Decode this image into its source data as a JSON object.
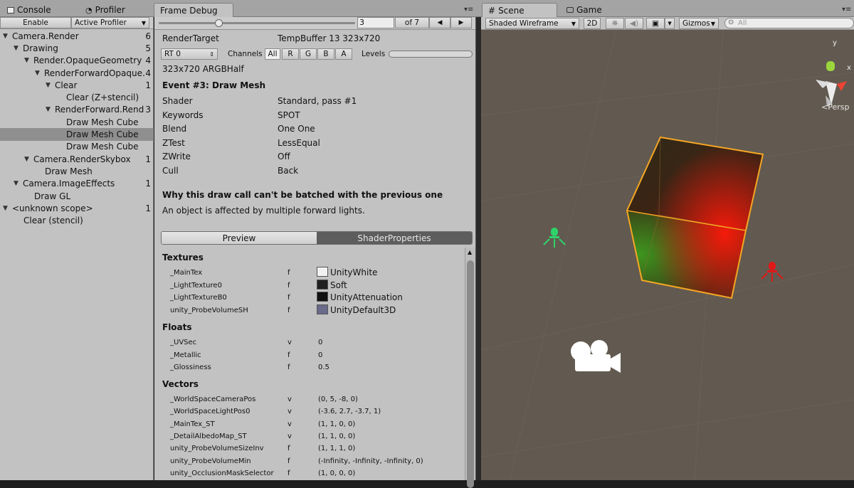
{
  "tabs": {
    "console": "Console",
    "profiler": "Profiler",
    "frame_debug": "Frame Debug",
    "scene": "Scene",
    "game": "Game"
  },
  "toolbar": {
    "enable": "Enable",
    "active_profiler": "Active Profiler",
    "current_event": "3",
    "of_total": "of 7",
    "prev": "◀",
    "next": "▶"
  },
  "tree": [
    {
      "label": "Camera.Render",
      "count": "6",
      "indent": 0,
      "expanded": true
    },
    {
      "label": "Drawing",
      "count": "5",
      "indent": 1,
      "expanded": true
    },
    {
      "label": "Render.OpaqueGeometry",
      "count": "4",
      "indent": 2,
      "expanded": true
    },
    {
      "label": "RenderForwardOpaque.",
      "count": "4",
      "indent": 3,
      "expanded": true
    },
    {
      "label": "Clear",
      "count": "1",
      "indent": 4,
      "expanded": true
    },
    {
      "label": "Clear (Z+stencil)",
      "count": "",
      "indent": 5
    },
    {
      "label": "RenderForward.Rend",
      "count": "3",
      "indent": 4,
      "expanded": true
    },
    {
      "label": "Draw Mesh Cube",
      "count": "",
      "indent": 5
    },
    {
      "label": "Draw Mesh Cube",
      "count": "",
      "indent": 5,
      "selected": true
    },
    {
      "label": "Draw Mesh Cube",
      "count": "",
      "indent": 5
    },
    {
      "label": "Camera.RenderSkybox",
      "count": "1",
      "indent": 2,
      "expanded": true
    },
    {
      "label": "Draw Mesh",
      "count": "",
      "indent": 3
    },
    {
      "label": "Camera.ImageEffects",
      "count": "1",
      "indent": 1,
      "expanded": true
    },
    {
      "label": "Draw GL",
      "count": "",
      "indent": 2
    },
    {
      "label": "<unknown scope>",
      "count": "1",
      "indent": 0,
      "expanded": true
    },
    {
      "label": "Clear (stencil)",
      "count": "",
      "indent": 1
    }
  ],
  "details": {
    "render_target_label": "RenderTarget",
    "render_target_value": "TempBuffer 13 323x720",
    "rt_select": "RT 0",
    "channels_label": "Channels",
    "channels": [
      "All",
      "R",
      "G",
      "B",
      "A"
    ],
    "levels_label": "Levels",
    "format": "323x720 ARGBHalf",
    "event_title": "Event #3: Draw Mesh",
    "props": [
      {
        "k": "Shader",
        "v": "Standard, pass #1"
      },
      {
        "k": "Keywords",
        "v": "SPOT"
      },
      {
        "k": "Blend",
        "v": "One One"
      },
      {
        "k": "ZTest",
        "v": "LessEqual"
      },
      {
        "k": "ZWrite",
        "v": "Off"
      },
      {
        "k": "Cull",
        "v": "Back"
      }
    ],
    "batch_title": "Why this draw call can't be batched with the previous one",
    "batch_reason": "An object is affected by multiple forward lights.",
    "preview_tab": "Preview",
    "shader_props_tab": "ShaderProperties",
    "textures_header": "Textures",
    "textures": [
      {
        "name": "_MainTex",
        "type": "f",
        "value": "UnityWhite",
        "color": "#f2f2f2"
      },
      {
        "name": "_LightTexture0",
        "type": "f",
        "value": "Soft",
        "color": "#202020"
      },
      {
        "name": "_LightTextureB0",
        "type": "f",
        "value": "UnityAttenuation",
        "color": "#101010"
      },
      {
        "name": "unity_ProbeVolumeSH",
        "type": "f",
        "value": "UnityDefault3D",
        "color": "#6a6a8a"
      }
    ],
    "floats_header": "Floats",
    "floats": [
      {
        "name": "_UVSec",
        "type": "v",
        "value": "0"
      },
      {
        "name": "_Metallic",
        "type": "f",
        "value": "0"
      },
      {
        "name": "_Glossiness",
        "type": "f",
        "value": "0.5"
      }
    ],
    "vectors_header": "Vectors",
    "vectors": [
      {
        "name": "_WorldSpaceCameraPos",
        "type": "v",
        "value": "(0, 5, -8, 0)"
      },
      {
        "name": "_WorldSpaceLightPos0",
        "type": "v",
        "value": "(-3.6, 2.7, -3.7, 1)"
      },
      {
        "name": "_MainTex_ST",
        "type": "v",
        "value": "(1, 1, 0, 0)"
      },
      {
        "name": "_DetailAlbedoMap_ST",
        "type": "v",
        "value": "(1, 1, 0, 0)"
      },
      {
        "name": "unity_ProbeVolumeSizeInv",
        "type": "f",
        "value": "(1, 1, 1, 0)"
      },
      {
        "name": "unity_ProbeVolumeMin",
        "type": "f",
        "value": "(-Infinity, -Infinity, -Infinity, 0)"
      },
      {
        "name": "unity_OcclusionMaskSelector",
        "type": "f",
        "value": "(1, 0, 0, 0)"
      }
    ]
  },
  "scene": {
    "shading_mode": "Shaded Wireframe",
    "mode_2d": "2D",
    "gizmos": "Gizmos",
    "search_placeholder": "All",
    "persp": "Persp",
    "axis_y": "y",
    "axis_x": "x",
    "bg_color": "#625a50",
    "cube_outline_color": "#f5a623"
  },
  "colors": {
    "panel": "#c2c2c2",
    "selected_row": "#8f8f8f",
    "light_green": "#2fd46a",
    "light_red": "#e01818"
  }
}
